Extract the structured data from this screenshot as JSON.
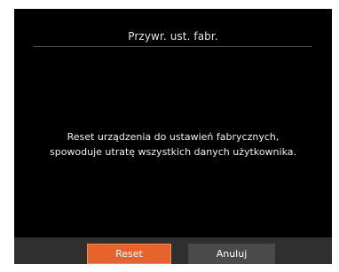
{
  "dialog": {
    "title": "Przywr. ust. fabr.",
    "message_line1": "Reset urządzenia do ustawień fabrycznych,",
    "message_line2": "spowoduje utratę wszystkich danych użytkownika."
  },
  "buttons": {
    "reset_label": "Reset",
    "cancel_label": "Anuluj"
  },
  "colors": {
    "background": "#000000",
    "footer": "#2f2f2f",
    "primary_button": "#e8632b",
    "secondary_button": "#4a4a4a"
  }
}
